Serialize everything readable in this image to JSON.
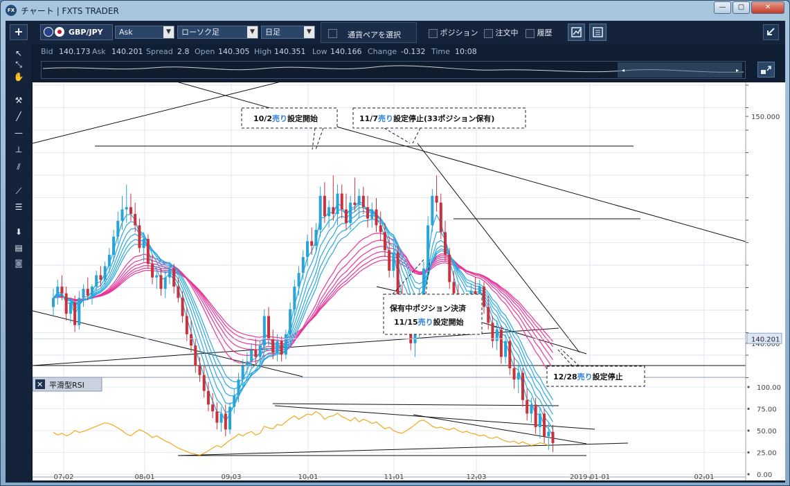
{
  "window": {
    "title": "チャート | FXTS TRADER",
    "app_icon": "FX",
    "min": "—",
    "max": "▢",
    "close": "✕"
  },
  "toolbar": {
    "add": "+",
    "symbol": "GBP/JPY",
    "price_type": "Ask",
    "chart_type": "ローソク足",
    "timeframe": "日足",
    "pair_select": "通貨ペアを選択",
    "position": "ポジション",
    "orders": "注文中",
    "history": "履歴"
  },
  "quote": {
    "bid_label": "Bid",
    "bid": "140.173",
    "ask_label": "Ask",
    "ask": "140.201",
    "spread_label": "Spread",
    "spread": "2.8",
    "open_label": "Open",
    "open": "140.305",
    "high_label": "High",
    "high": "140.351",
    "low_label": "Low",
    "low": "140.166",
    "change_label": "Change",
    "change": "-0.132",
    "time_label": "Time",
    "time": "10:08"
  },
  "annotations": [
    {
      "title": "10/2",
      "word": "売り",
      "rest": "設定開始"
    },
    {
      "title": "11/7",
      "word": "売り",
      "rest": "設定停止(33ポジション保有)"
    },
    {
      "line1": "保有中ポジション決済",
      "title": "11/15",
      "word": "売り",
      "rest": "設定開始"
    },
    {
      "title": "12/28",
      "word": "売り",
      "rest": "設定停止"
    }
  ],
  "indicator": {
    "close": "✕",
    "name": "平滑型RSI"
  },
  "colors": {
    "bg": "#ffffff",
    "up": "#2aa4d8",
    "down": "#c8323c",
    "ribbon_fast": "#29a8e0",
    "ribbon_slow": "#e8359a",
    "rsi": "#f2a81c",
    "sell_word": "#2f80d8"
  },
  "chart_data": {
    "type": "candlestick",
    "symbol": "GBP/JPY",
    "price_ticks": [
      "150.000",
      "140.000"
    ],
    "current_price": "140.201",
    "rsi_ticks": [
      "100.00",
      "75.00",
      "50.00",
      "25.00",
      "0.00"
    ],
    "x_ticks": [
      "07-02",
      "08-01",
      "09-03",
      "10-01",
      "11-01",
      "12-03",
      "2019-01-01",
      "02-01"
    ],
    "price_range": [
      138.5,
      151.5
    ],
    "rsi_range": [
      0,
      100
    ],
    "candles": [
      {
        "o": 141.6,
        "h": 142.4,
        "l": 141.2,
        "c": 142.0
      },
      {
        "o": 142.0,
        "h": 142.8,
        "l": 141.7,
        "c": 142.5
      },
      {
        "o": 142.5,
        "h": 143.0,
        "l": 141.9,
        "c": 142.2
      },
      {
        "o": 142.2,
        "h": 142.5,
        "l": 141.0,
        "c": 141.3
      },
      {
        "o": 141.3,
        "h": 142.0,
        "l": 140.9,
        "c": 141.8
      },
      {
        "o": 141.8,
        "h": 142.1,
        "l": 140.5,
        "c": 140.8
      },
      {
        "o": 140.8,
        "h": 142.3,
        "l": 140.6,
        "c": 142.0
      },
      {
        "o": 142.0,
        "h": 142.6,
        "l": 141.6,
        "c": 142.4
      },
      {
        "o": 142.4,
        "h": 142.9,
        "l": 141.9,
        "c": 142.1
      },
      {
        "o": 142.1,
        "h": 142.6,
        "l": 141.7,
        "c": 142.5
      },
      {
        "o": 142.5,
        "h": 143.2,
        "l": 142.3,
        "c": 143.0
      },
      {
        "o": 143.0,
        "h": 143.4,
        "l": 142.5,
        "c": 142.8
      },
      {
        "o": 142.8,
        "h": 143.6,
        "l": 142.6,
        "c": 143.4
      },
      {
        "o": 143.4,
        "h": 144.2,
        "l": 143.1,
        "c": 143.9
      },
      {
        "o": 143.9,
        "h": 145.0,
        "l": 143.6,
        "c": 144.7
      },
      {
        "o": 144.7,
        "h": 145.8,
        "l": 144.4,
        "c": 145.4
      },
      {
        "o": 145.4,
        "h": 146.5,
        "l": 145.0,
        "c": 145.9
      },
      {
        "o": 145.9,
        "h": 147.0,
        "l": 145.3,
        "c": 146.0
      },
      {
        "o": 146.0,
        "h": 146.6,
        "l": 145.4,
        "c": 145.7
      },
      {
        "o": 145.7,
        "h": 146.2,
        "l": 144.9,
        "c": 145.2
      },
      {
        "o": 145.2,
        "h": 145.5,
        "l": 144.0,
        "c": 144.2
      },
      {
        "o": 144.2,
        "h": 144.9,
        "l": 143.6,
        "c": 144.6
      },
      {
        "o": 144.6,
        "h": 144.8,
        "l": 143.3,
        "c": 143.5
      },
      {
        "o": 143.5,
        "h": 143.9,
        "l": 142.6,
        "c": 142.9
      },
      {
        "o": 142.9,
        "h": 143.4,
        "l": 142.4,
        "c": 143.0
      },
      {
        "o": 143.0,
        "h": 143.3,
        "l": 142.1,
        "c": 142.4
      },
      {
        "o": 142.4,
        "h": 143.2,
        "l": 142.0,
        "c": 142.9
      },
      {
        "o": 142.9,
        "h": 143.6,
        "l": 142.6,
        "c": 143.3
      },
      {
        "o": 143.3,
        "h": 143.5,
        "l": 142.2,
        "c": 142.5
      },
      {
        "o": 142.5,
        "h": 142.9,
        "l": 141.8,
        "c": 142.0
      },
      {
        "o": 142.0,
        "h": 142.3,
        "l": 140.9,
        "c": 141.2
      },
      {
        "o": 141.2,
        "h": 141.6,
        "l": 140.1,
        "c": 140.4
      },
      {
        "o": 140.4,
        "h": 141.0,
        "l": 139.6,
        "c": 139.9
      },
      {
        "o": 139.9,
        "h": 140.2,
        "l": 138.7,
        "c": 139.0
      },
      {
        "o": 139.0,
        "h": 139.4,
        "l": 138.3,
        "c": 138.6
      },
      {
        "o": 138.6,
        "h": 139.0,
        "l": 137.6,
        "c": 137.9
      },
      {
        "o": 137.9,
        "h": 138.3,
        "l": 137.0,
        "c": 137.3
      },
      {
        "o": 137.3,
        "h": 137.8,
        "l": 136.7,
        "c": 137.0
      },
      {
        "o": 137.0,
        "h": 137.4,
        "l": 136.2,
        "c": 136.5
      },
      {
        "o": 136.5,
        "h": 137.2,
        "l": 136.1,
        "c": 136.9
      },
      {
        "o": 136.9,
        "h": 137.3,
        "l": 135.9,
        "c": 136.2
      },
      {
        "o": 136.2,
        "h": 137.4,
        "l": 136.0,
        "c": 137.2
      },
      {
        "o": 137.2,
        "h": 138.0,
        "l": 136.9,
        "c": 137.7
      },
      {
        "o": 137.7,
        "h": 138.7,
        "l": 137.4,
        "c": 138.4
      },
      {
        "o": 138.4,
        "h": 139.3,
        "l": 138.1,
        "c": 139.0
      },
      {
        "o": 139.0,
        "h": 139.6,
        "l": 138.6,
        "c": 139.2
      },
      {
        "o": 139.2,
        "h": 140.0,
        "l": 138.9,
        "c": 139.7
      },
      {
        "o": 139.7,
        "h": 140.2,
        "l": 139.0,
        "c": 139.4
      },
      {
        "o": 139.4,
        "h": 140.1,
        "l": 139.1,
        "c": 139.9
      },
      {
        "o": 139.9,
        "h": 141.5,
        "l": 139.6,
        "c": 141.2
      },
      {
        "o": 141.2,
        "h": 141.6,
        "l": 139.9,
        "c": 140.2
      },
      {
        "o": 140.2,
        "h": 140.6,
        "l": 139.3,
        "c": 139.6
      },
      {
        "o": 139.6,
        "h": 140.4,
        "l": 139.2,
        "c": 140.1
      },
      {
        "o": 140.1,
        "h": 140.3,
        "l": 139.2,
        "c": 139.5
      },
      {
        "o": 139.5,
        "h": 140.6,
        "l": 139.3,
        "c": 140.4
      },
      {
        "o": 140.4,
        "h": 141.8,
        "l": 140.1,
        "c": 141.5
      },
      {
        "o": 141.5,
        "h": 142.8,
        "l": 141.2,
        "c": 142.5
      },
      {
        "o": 142.5,
        "h": 143.4,
        "l": 142.1,
        "c": 143.1
      },
      {
        "o": 143.1,
        "h": 144.1,
        "l": 142.8,
        "c": 143.8
      },
      {
        "o": 143.8,
        "h": 144.8,
        "l": 143.4,
        "c": 144.5
      },
      {
        "o": 144.5,
        "h": 145.1,
        "l": 143.9,
        "c": 144.3
      },
      {
        "o": 144.3,
        "h": 145.3,
        "l": 144.0,
        "c": 145.0
      },
      {
        "o": 145.0,
        "h": 146.9,
        "l": 144.7,
        "c": 146.5
      },
      {
        "o": 146.5,
        "h": 147.1,
        "l": 145.3,
        "c": 145.6
      },
      {
        "o": 145.6,
        "h": 146.3,
        "l": 145.1,
        "c": 146.0
      },
      {
        "o": 146.0,
        "h": 147.4,
        "l": 145.4,
        "c": 145.7
      },
      {
        "o": 145.7,
        "h": 147.0,
        "l": 145.2,
        "c": 146.6
      },
      {
        "o": 146.6,
        "h": 147.0,
        "l": 145.5,
        "c": 145.9
      },
      {
        "o": 145.9,
        "h": 146.6,
        "l": 145.0,
        "c": 145.3
      },
      {
        "o": 145.3,
        "h": 146.5,
        "l": 145.0,
        "c": 146.2
      },
      {
        "o": 146.2,
        "h": 147.3,
        "l": 145.8,
        "c": 146.1
      },
      {
        "o": 146.1,
        "h": 146.8,
        "l": 145.5,
        "c": 146.5
      },
      {
        "o": 146.5,
        "h": 146.9,
        "l": 145.7,
        "c": 146.0
      },
      {
        "o": 146.0,
        "h": 146.5,
        "l": 145.1,
        "c": 145.5
      },
      {
        "o": 145.5,
        "h": 146.2,
        "l": 145.1,
        "c": 145.9
      },
      {
        "o": 145.9,
        "h": 146.4,
        "l": 144.9,
        "c": 145.2
      },
      {
        "o": 145.2,
        "h": 145.8,
        "l": 144.5,
        "c": 144.9
      },
      {
        "o": 144.9,
        "h": 145.3,
        "l": 143.8,
        "c": 144.1
      },
      {
        "o": 144.1,
        "h": 144.6,
        "l": 142.9,
        "c": 143.2
      },
      {
        "o": 143.2,
        "h": 144.4,
        "l": 142.9,
        "c": 144.0
      },
      {
        "o": 144.0,
        "h": 144.3,
        "l": 141.8,
        "c": 142.1
      },
      {
        "o": 142.1,
        "h": 142.6,
        "l": 140.8,
        "c": 141.1
      },
      {
        "o": 141.1,
        "h": 141.9,
        "l": 140.5,
        "c": 141.6
      },
      {
        "o": 141.6,
        "h": 141.9,
        "l": 139.7,
        "c": 140.0
      },
      {
        "o": 140.0,
        "h": 140.8,
        "l": 139.4,
        "c": 140.5
      },
      {
        "o": 140.5,
        "h": 142.4,
        "l": 140.2,
        "c": 142.1
      },
      {
        "o": 142.1,
        "h": 143.6,
        "l": 141.8,
        "c": 143.3
      },
      {
        "o": 143.3,
        "h": 145.6,
        "l": 143.0,
        "c": 145.2
      },
      {
        "o": 145.2,
        "h": 146.8,
        "l": 144.9,
        "c": 146.5
      },
      {
        "o": 146.5,
        "h": 147.4,
        "l": 145.8,
        "c": 146.2
      },
      {
        "o": 146.2,
        "h": 146.6,
        "l": 144.6,
        "c": 144.9
      },
      {
        "o": 144.9,
        "h": 145.4,
        "l": 143.6,
        "c": 143.9
      },
      {
        "o": 143.9,
        "h": 144.2,
        "l": 142.4,
        "c": 142.7
      },
      {
        "o": 142.7,
        "h": 143.2,
        "l": 141.9,
        "c": 142.2
      },
      {
        "o": 142.2,
        "h": 142.6,
        "l": 141.1,
        "c": 141.4
      },
      {
        "o": 141.4,
        "h": 142.0,
        "l": 140.7,
        "c": 141.7
      },
      {
        "o": 141.7,
        "h": 142.2,
        "l": 140.9,
        "c": 141.2
      },
      {
        "o": 141.2,
        "h": 142.6,
        "l": 140.9,
        "c": 142.3
      },
      {
        "o": 142.3,
        "h": 142.9,
        "l": 141.7,
        "c": 142.0
      },
      {
        "o": 142.0,
        "h": 142.8,
        "l": 141.7,
        "c": 142.5
      },
      {
        "o": 142.5,
        "h": 142.7,
        "l": 141.3,
        "c": 141.6
      },
      {
        "o": 141.6,
        "h": 142.1,
        "l": 140.6,
        "c": 140.9
      },
      {
        "o": 140.9,
        "h": 141.2,
        "l": 139.8,
        "c": 140.1
      },
      {
        "o": 140.1,
        "h": 141.0,
        "l": 139.7,
        "c": 140.6
      },
      {
        "o": 140.6,
        "h": 140.8,
        "l": 139.1,
        "c": 139.4
      },
      {
        "o": 139.4,
        "h": 140.4,
        "l": 139.1,
        "c": 140.1
      },
      {
        "o": 140.1,
        "h": 140.3,
        "l": 138.6,
        "c": 138.9
      },
      {
        "o": 138.9,
        "h": 139.4,
        "l": 138.0,
        "c": 138.4
      },
      {
        "o": 138.4,
        "h": 139.0,
        "l": 137.8,
        "c": 138.7
      },
      {
        "o": 138.7,
        "h": 138.9,
        "l": 137.2,
        "c": 137.5
      },
      {
        "o": 137.5,
        "h": 138.0,
        "l": 136.6,
        "c": 136.9
      },
      {
        "o": 136.9,
        "h": 137.6,
        "l": 136.5,
        "c": 137.3
      },
      {
        "o": 137.3,
        "h": 137.6,
        "l": 136.0,
        "c": 136.3
      },
      {
        "o": 136.3,
        "h": 137.2,
        "l": 135.8,
        "c": 136.9
      },
      {
        "o": 136.9,
        "h": 137.1,
        "l": 135.6,
        "c": 135.9
      },
      {
        "o": 135.9,
        "h": 136.5,
        "l": 135.3,
        "c": 136.1
      },
      {
        "o": 136.1,
        "h": 136.4,
        "l": 135.2,
        "c": 135.6
      }
    ],
    "rsi": [
      48,
      45,
      47,
      44,
      46,
      50,
      48,
      49,
      51,
      53,
      55,
      57,
      59,
      58,
      56,
      53,
      50,
      46,
      44,
      48,
      51,
      49,
      46,
      42,
      44,
      41,
      38,
      36,
      33,
      30,
      28,
      26,
      24,
      23,
      22,
      24,
      27,
      30,
      33,
      31,
      35,
      39,
      42,
      46,
      44,
      47,
      49,
      45,
      47,
      55,
      53,
      52,
      57,
      56,
      60,
      64,
      67,
      63,
      66,
      69,
      68,
      72,
      69,
      63,
      66,
      67,
      70,
      66,
      64,
      61,
      65,
      60,
      63,
      61,
      58,
      60,
      56,
      52,
      54,
      50,
      48,
      47,
      50,
      53,
      57,
      61,
      62,
      59,
      55,
      53,
      54,
      52,
      51,
      53,
      50,
      48,
      49,
      47,
      46,
      44,
      45,
      42,
      41,
      43,
      40,
      38,
      37,
      38,
      35,
      37,
      35,
      33,
      34,
      36,
      35,
      33
    ]
  }
}
